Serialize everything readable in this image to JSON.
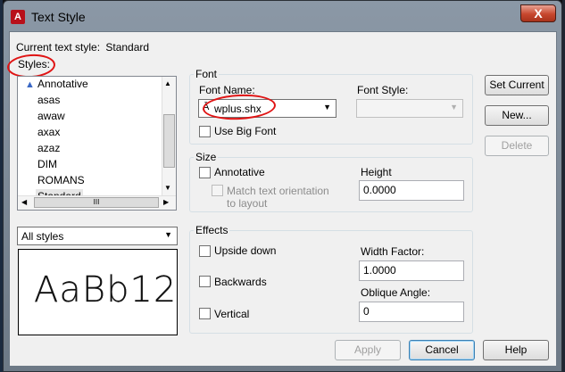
{
  "window": {
    "title": "Text Style",
    "close_glyph": "X",
    "app_icon": "autocad-icon"
  },
  "current_style": {
    "label": "Current text style:",
    "value": "Standard"
  },
  "styles": {
    "label": "Styles:",
    "items": [
      {
        "label": "Annotative",
        "icon": "annotative-icon"
      },
      {
        "label": "asas"
      },
      {
        "label": "awaw"
      },
      {
        "label": "axax"
      },
      {
        "label": "azaz"
      },
      {
        "label": "DIM"
      },
      {
        "label": "ROMANS"
      },
      {
        "label": "Standard",
        "selected": true
      }
    ],
    "filter": "All styles"
  },
  "preview": {
    "text": "AaBb12"
  },
  "font": {
    "group_title": "Font",
    "font_name_label": "Font Name:",
    "font_name_value": "wplus.shx",
    "font_style_label": "Font Style:",
    "font_style_value": "",
    "big_font_label": "Use Big Font"
  },
  "size": {
    "group_title": "Size",
    "annotative_label": "Annotative",
    "match_orientation_label_1": "Match text orientation",
    "match_orientation_label_2": "to layout",
    "height_label": "Height",
    "height_value": "0.0000"
  },
  "effects": {
    "group_title": "Effects",
    "upside_down_label": "Upside down",
    "backwards_label": "Backwards",
    "vertical_label": "Vertical",
    "width_factor_label": "Width Factor:",
    "width_factor_value": "1.0000",
    "oblique_angle_label": "Oblique Angle:",
    "oblique_angle_value": "0"
  },
  "buttons": {
    "set_current": "Set Current",
    "new": "New...",
    "delete": "Delete",
    "apply": "Apply",
    "cancel": "Cancel",
    "help": "Help"
  },
  "scrollbar": {
    "hgrip": "III"
  },
  "colors": {
    "annotation_red": "#e01414",
    "title_gradient_top": "#8b98a6",
    "dialog_face": "#f0f0f0"
  }
}
